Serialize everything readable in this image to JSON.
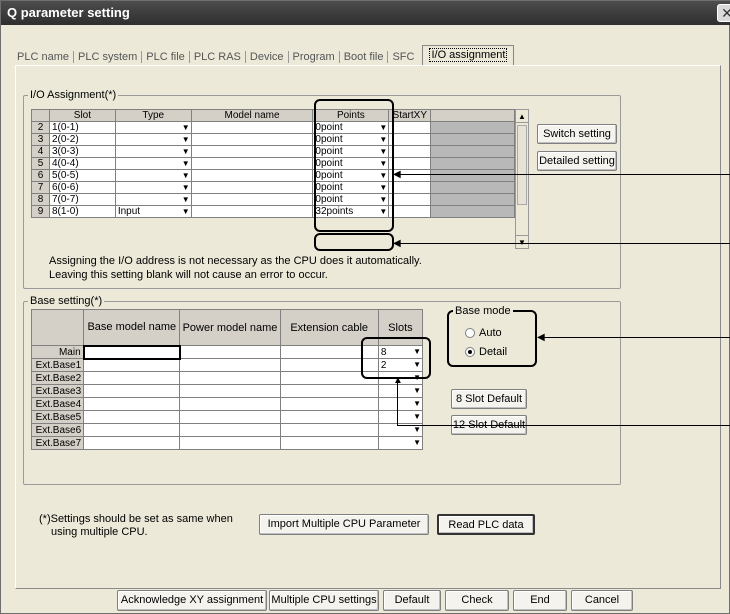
{
  "window": {
    "title": "Q parameter setting",
    "close_glyph": "✕"
  },
  "tabs": [
    "PLC name",
    "PLC system",
    "PLC file",
    "PLC RAS",
    "Device",
    "Program",
    "Boot file",
    "SFC",
    "I/O assignment"
  ],
  "io_assignment": {
    "legend": "I/O Assignment(*)",
    "headers": [
      "Slot",
      "Type",
      "Model name",
      "Points",
      "StartXY"
    ],
    "rows": [
      {
        "num": "2",
        "slot": "1(0-1)",
        "type": "",
        "model": "",
        "points": "0point"
      },
      {
        "num": "3",
        "slot": "2(0-2)",
        "type": "",
        "model": "",
        "points": "0point"
      },
      {
        "num": "4",
        "slot": "3(0-3)",
        "type": "",
        "model": "",
        "points": "0point"
      },
      {
        "num": "5",
        "slot": "4(0-4)",
        "type": "",
        "model": "",
        "points": "0point"
      },
      {
        "num": "6",
        "slot": "5(0-5)",
        "type": "",
        "model": "",
        "points": "0point"
      },
      {
        "num": "7",
        "slot": "6(0-6)",
        "type": "",
        "model": "",
        "points": "0point"
      },
      {
        "num": "8",
        "slot": "7(0-7)",
        "type": "",
        "model": "",
        "points": "0point"
      },
      {
        "num": "9",
        "slot": "8(1-0)",
        "type": "Input",
        "model": "",
        "points": "32points"
      }
    ],
    "switch_setting": "Switch setting",
    "detailed_setting": "Detailed setting",
    "note_line1": "Assigning the I/O address is not necessary as the CPU does it automatically.",
    "note_line2": "Leaving this setting blank will not cause an error to occur."
  },
  "base_setting": {
    "legend": "Base setting(*)",
    "headers": [
      "Base model name",
      "Power model name",
      "Extension cable",
      "Slots"
    ],
    "rows": [
      {
        "label": "Main",
        "slots": "8"
      },
      {
        "label": "Ext.Base1",
        "slots": "2"
      },
      {
        "label": "Ext.Base2",
        "slots": ""
      },
      {
        "label": "Ext.Base3",
        "slots": ""
      },
      {
        "label": "Ext.Base4",
        "slots": ""
      },
      {
        "label": "Ext.Base5",
        "slots": ""
      },
      {
        "label": "Ext.Base6",
        "slots": ""
      },
      {
        "label": "Ext.Base7",
        "slots": ""
      }
    ],
    "base_mode": {
      "legend": "Base mode",
      "auto": "Auto",
      "detail": "Detail",
      "selected": "Detail"
    },
    "slot8_default": "8 Slot Default",
    "slot12_default": "12 Slot Default"
  },
  "footnote_line1": "(*)Settings should be set as same when",
  "footnote_line2": "using multiple CPU.",
  "import_button": "Import Multiple CPU Parameter",
  "read_button": "Read PLC data",
  "bottom_buttons": [
    "Acknowledge XY assignment",
    "Multiple CPU settings",
    "Default",
    "Check",
    "End",
    "Cancel"
  ]
}
